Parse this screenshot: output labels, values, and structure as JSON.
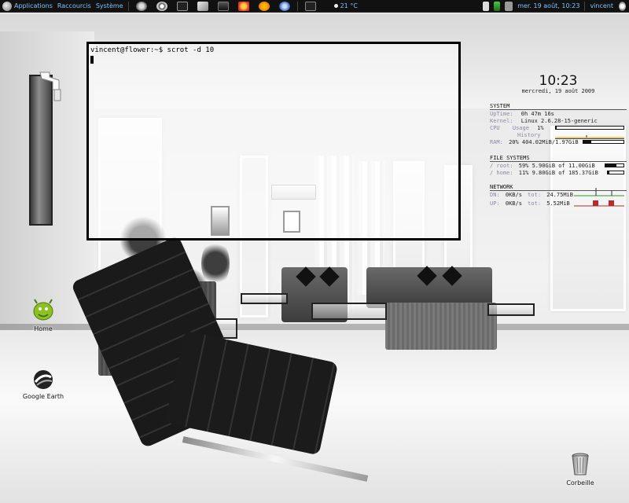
{
  "panel": {
    "menus": [
      {
        "label": "Applications",
        "icon": "gnome-foot-icon"
      },
      {
        "label": "Raccourcis"
      },
      {
        "label": "Système"
      }
    ],
    "launchers": [
      "gimp-icon",
      "system-monitor-icon",
      "terminal-icon",
      "text-editor-icon",
      "text-editor-icon-2",
      "nautilus-icon",
      "ubuntu-icon",
      "firefox-icon",
      "notes-icon"
    ],
    "weather": "21 °C",
    "datetime": "mer. 19 août, 10:23",
    "user": "vincent",
    "tray_icons": [
      "notification-icon",
      "keyboard-icon",
      "network-icon",
      "power-icon"
    ]
  },
  "terminal": {
    "prompt_line": "vincent@flower:~$ scrot -d 10"
  },
  "conky": {
    "time": "10:23",
    "date": "mercredi, 19 août 2009",
    "system": {
      "heading": "SYSTEM",
      "uptime_label": "UpTime:",
      "uptime_value": "0h 47m 16s",
      "kernel_label": "Kernel:",
      "kernel_value": "Linux 2.6.28-15-generic",
      "cpu_label": "CPU",
      "usage_label": "Usage",
      "usage_value": "1%",
      "cpu_usage": 1,
      "history_label": "History",
      "ram_label": "RAM:",
      "ram_value": "20% 404.02MiB/1.97GiB",
      "ram_usage": 20
    },
    "filesystems": {
      "heading": "FILE SYSTEMS",
      "rows": [
        {
          "label": "/ root:",
          "value": "59% 5.90GiB of 11.00GiB",
          "usage": 59
        },
        {
          "label": "/ home:",
          "value": "11% 9.80GiB of 185.37GiB",
          "usage": 11
        }
      ]
    },
    "network": {
      "heading": "NETWORK",
      "down_label": "DN:",
      "down_value": "0KB/s",
      "down_total_label": "tot:",
      "down_total": "24.75MiB",
      "up_label": "UP:",
      "up_value": "0KB/s",
      "up_total_label": "tot:",
      "up_total": "5.52MiB"
    }
  },
  "desktop": {
    "icons": [
      {
        "label": "Home"
      },
      {
        "label": "Google Earth"
      },
      {
        "label": "Corbeille"
      }
    ]
  },
  "colors": {
    "panel_bg": "#111111",
    "panel_text": "#7ec3ff",
    "graph_down": "#2a9a2a",
    "graph_up": "#b52a2a"
  }
}
